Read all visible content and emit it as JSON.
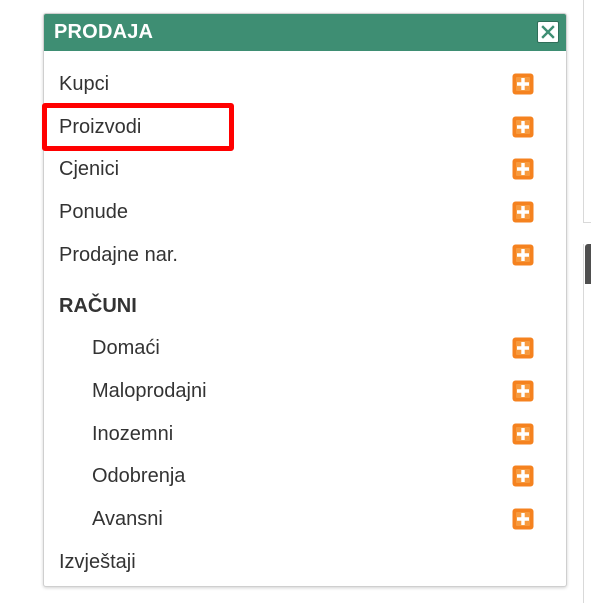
{
  "panel": {
    "title": "PRODAJA",
    "close_icon": "close-icon",
    "header_color": "#3e8e73",
    "highlight_color": "#ff0000",
    "expand_icon": "plus-square-icon",
    "expand_icon_color": "#f5821f"
  },
  "menu": {
    "items": [
      {
        "label": "Kupci",
        "expandable": true
      },
      {
        "label": "Proizvodi",
        "expandable": true,
        "highlighted": true
      },
      {
        "label": "Cjenici",
        "expandable": true
      },
      {
        "label": "Ponude",
        "expandable": true
      },
      {
        "label": "Prodajne nar.",
        "expandable": true
      }
    ],
    "section": {
      "heading": "RAČUNI",
      "items": [
        {
          "label": "Domaći",
          "expandable": true
        },
        {
          "label": "Maloprodajni",
          "expandable": true
        },
        {
          "label": "Inozemni",
          "expandable": true
        },
        {
          "label": "Odobrenja",
          "expandable": true
        },
        {
          "label": "Avansni",
          "expandable": true
        }
      ]
    },
    "footer_item": {
      "label": "Izvještaji",
      "expandable": false
    }
  }
}
